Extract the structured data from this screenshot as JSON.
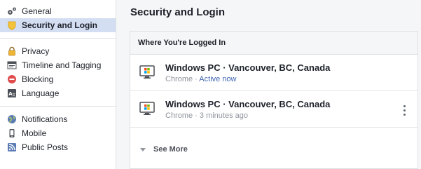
{
  "sidebar": {
    "items": [
      {
        "label": "General",
        "icon": "gear-icon"
      },
      {
        "label": "Security and Login",
        "icon": "shield-badge-icon"
      },
      {
        "label": "Privacy",
        "icon": "lock-icon"
      },
      {
        "label": "Timeline and Tagging",
        "icon": "timeline-icon"
      },
      {
        "label": "Blocking",
        "icon": "blocked-icon"
      },
      {
        "label": "Language",
        "icon": "language-icon"
      },
      {
        "label": "Notifications",
        "icon": "globe-icon"
      },
      {
        "label": "Mobile",
        "icon": "mobile-phone-icon"
      },
      {
        "label": "Public Posts",
        "icon": "rss-icon"
      }
    ]
  },
  "main": {
    "title": "Security and Login",
    "panel": {
      "header": "Where You're Logged In",
      "sessions": [
        {
          "device": "Windows PC · Vancouver, BC, Canada",
          "browser": "Chrome",
          "separator": " · ",
          "status": "Active now"
        },
        {
          "device": "Windows PC · Vancouver, BC, Canada",
          "browser": "Chrome",
          "separator": " · ",
          "status": "3 minutes ago"
        }
      ],
      "see_more": "See More"
    }
  },
  "colors": {
    "accent": "#4267b2",
    "active_bg": "#d4def2",
    "muted": "#90949c"
  }
}
